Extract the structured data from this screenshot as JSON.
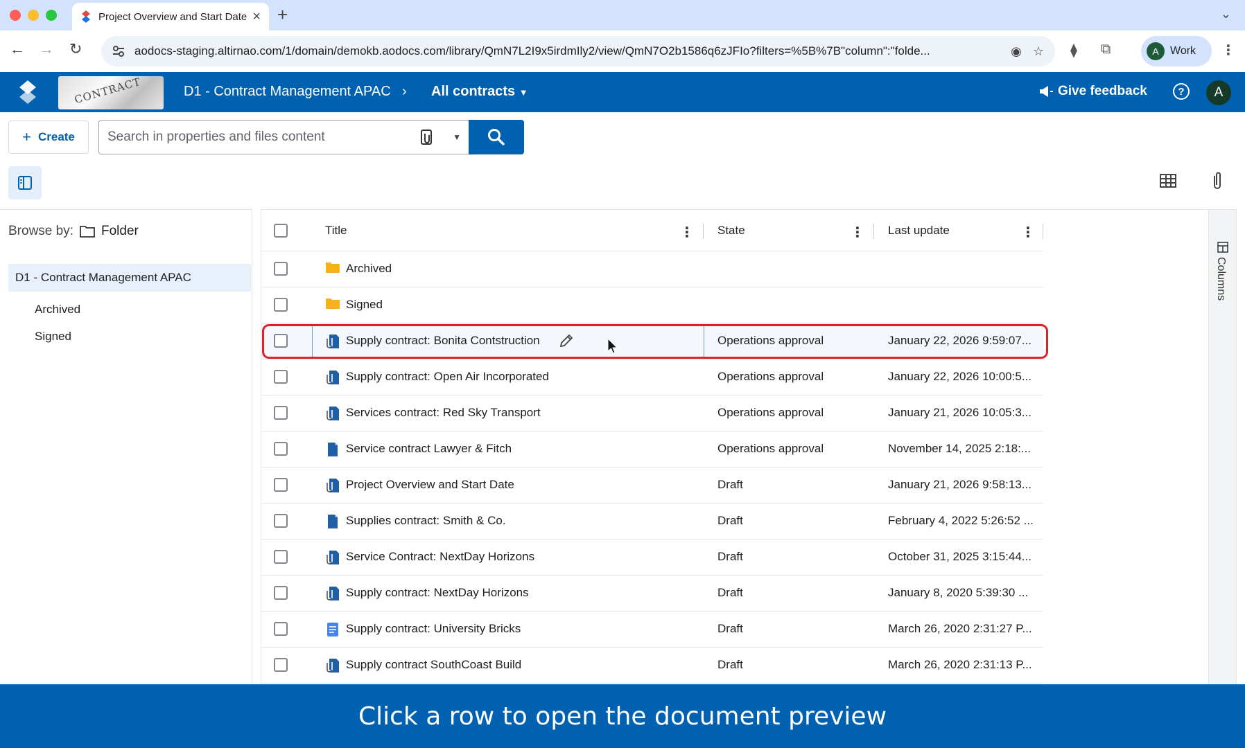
{
  "browser": {
    "tab_title": "Project Overview and Start Date",
    "url": "aodocs-staging.altirnao.com/1/domain/demokb.aodocs.com/library/QmN7L2I9x5irdmIly2/view/QmN7O2b1586q6zJFIo?filters=%5B%7B\"column\":\"folde...",
    "profile_label": "Work",
    "profile_initial": "A"
  },
  "header": {
    "logo_image_text": "CONTRACT",
    "library_name": "D1 - Contract Management APAC",
    "view_name": "All contracts",
    "feedback_label": "Give feedback",
    "help_symbol": "?",
    "user_initial": "A"
  },
  "actions": {
    "create_label": "Create",
    "search_placeholder": "Search in properties and files content"
  },
  "sidebar": {
    "browse_label": "Browse by:",
    "browse_mode": "Folder",
    "root": "D1 - Contract Management APAC",
    "children": [
      "Archived",
      "Signed"
    ]
  },
  "table": {
    "columns": [
      "Title",
      "State",
      "Last update"
    ],
    "side_panel_label": "Columns",
    "rows": [
      {
        "title": "Archived",
        "state": "",
        "date": "",
        "icon": "folder-icon"
      },
      {
        "title": "Signed",
        "state": "",
        "date": "",
        "icon": "folder-icon"
      },
      {
        "title": "Supply contract: Bonita Contstruction",
        "state": "Operations approval",
        "date": "January 22, 2026 9:59:07...",
        "icon": "attachment-doc-icon"
      },
      {
        "title": "Supply contract: Open Air Incorporated",
        "state": "Operations approval",
        "date": "January 22, 2026 10:00:5...",
        "icon": "attachment-doc-icon"
      },
      {
        "title": "Services contract: Red Sky Transport",
        "state": "Operations approval",
        "date": "January 21, 2026 10:05:3...",
        "icon": "attachment-doc-icon"
      },
      {
        "title": "Service contract Lawyer & Fitch",
        "state": "Operations approval",
        "date": "November 14, 2025 2:18:...",
        "icon": "document-icon"
      },
      {
        "title": "Project Overview and Start Date",
        "state": "Draft",
        "date": "January 21, 2026 9:58:13...",
        "icon": "attachment-doc-icon"
      },
      {
        "title": "Supplies contract: Smith & Co.",
        "state": "Draft",
        "date": "February 4, 2022 5:26:52 ...",
        "icon": "document-icon"
      },
      {
        "title": "Service Contract: NextDay Horizons",
        "state": "Draft",
        "date": "October 31, 2025 3:15:44...",
        "icon": "attachment-doc-icon"
      },
      {
        "title": "Supply contract: NextDay Horizons",
        "state": "Draft",
        "date": "January 8, 2020 5:39:30 ...",
        "icon": "attachment-doc-icon"
      },
      {
        "title": "Supply contract: University Bricks",
        "state": "Draft",
        "date": "March 26, 2020 2:31:27 P...",
        "icon": "google-doc-icon"
      },
      {
        "title": "Supply contract SouthCoast Build",
        "state": "Draft",
        "date": "March 26, 2020 2:31:13 P...",
        "icon": "attachment-doc-icon"
      }
    ]
  },
  "caption": "Click a row to open the document preview",
  "colors": {
    "brand": "#0061b0",
    "highlight": "#e0202b",
    "folder": "#f9b117"
  }
}
